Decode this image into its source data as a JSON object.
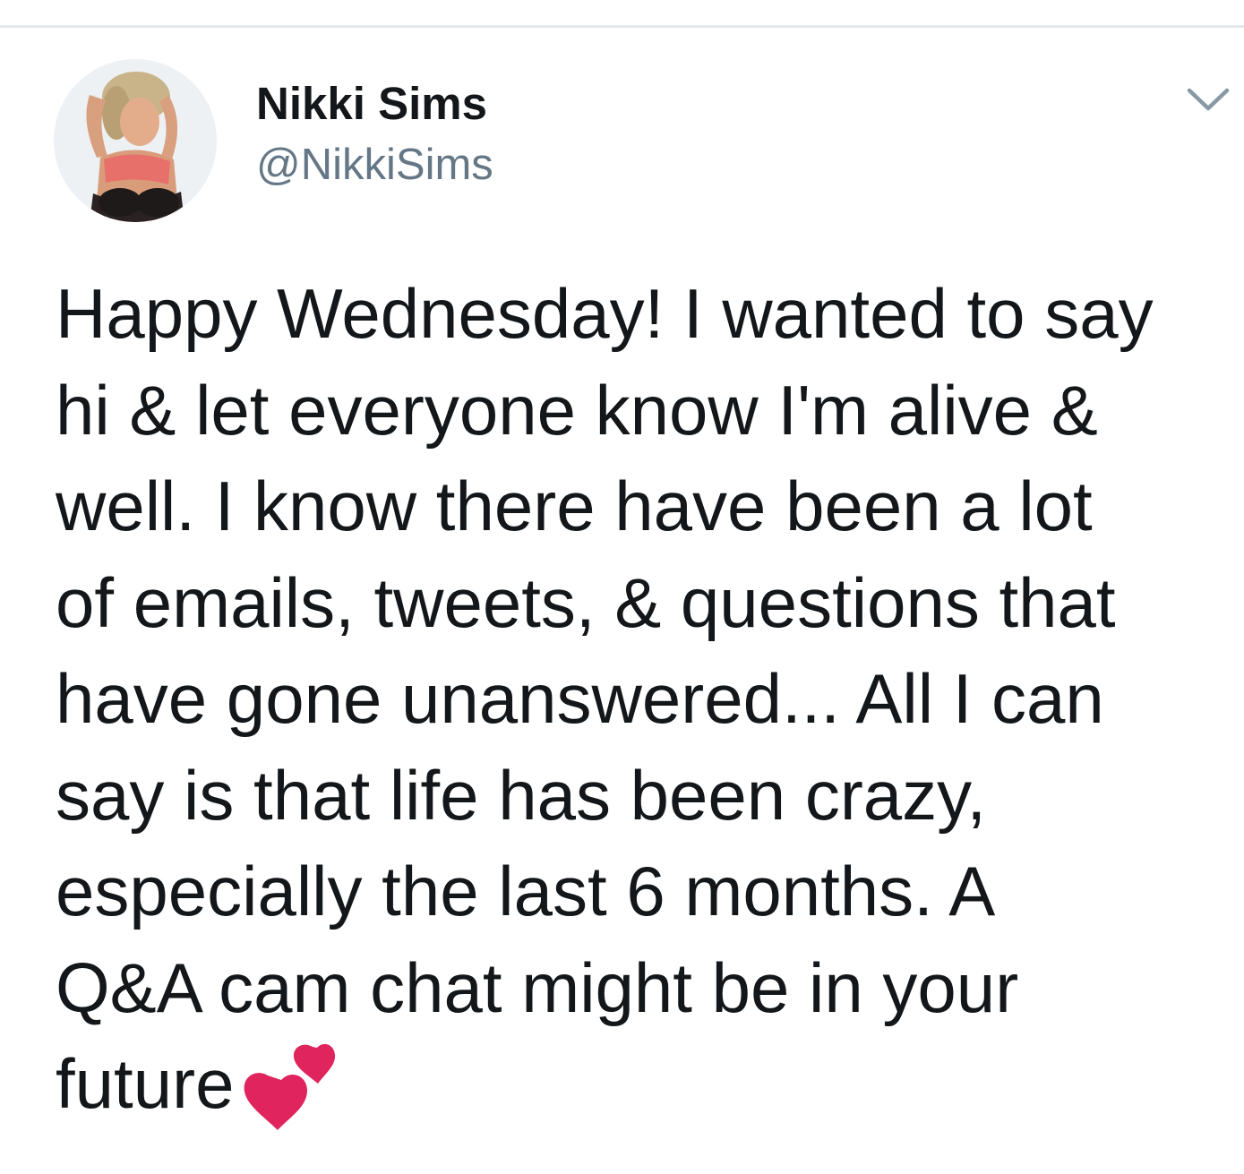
{
  "tweet": {
    "author": {
      "display_name": "Nikki Sims",
      "handle": "@NikkiSims",
      "avatar_icon": "profile-photo"
    },
    "menu_icon": "chevron-down-icon",
    "text": "Happy Wednesday! I wanted to say\nhi & let everyone know I'm alive &\nwell. I know there have been a lot\nof emails, tweets, & questions that\nhave gone unanswered... All I can\nsay is that life has been crazy,\nespecially the last 6 months. A\nQ&A cam chat might be in your\nfuture",
    "emoji": "two-hearts-icon"
  },
  "colors": {
    "text": "#14171a",
    "secondary_text": "#657786",
    "divider": "#e1e8ed",
    "heart": "#e0245e"
  }
}
